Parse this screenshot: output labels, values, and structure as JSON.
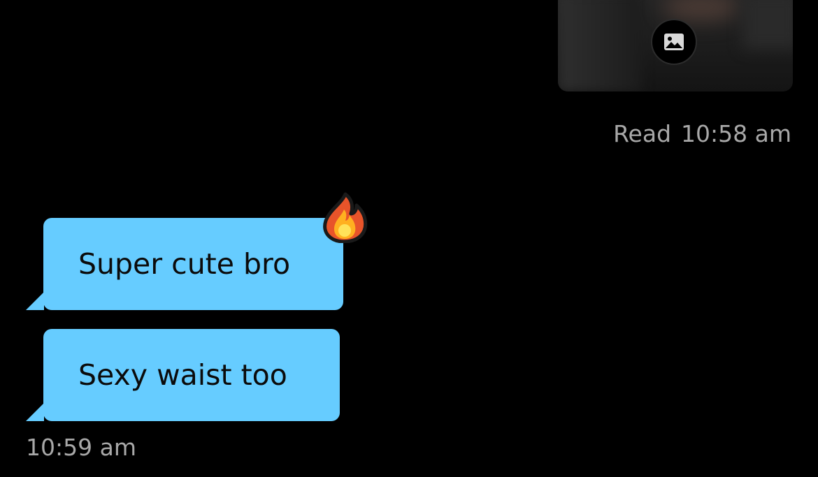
{
  "sent_message": {
    "attachment_icon": "image-icon",
    "read_label": "Read",
    "read_time": "10:58 am"
  },
  "received_messages": [
    {
      "text": "Super cute bro",
      "reaction": "fire-emoji"
    },
    {
      "text": "Sexy waist too"
    }
  ],
  "received_timestamp": "10:59 am",
  "colors": {
    "background": "#000000",
    "received_bubble": "#66ccff",
    "meta_text": "#a8a8a8"
  }
}
